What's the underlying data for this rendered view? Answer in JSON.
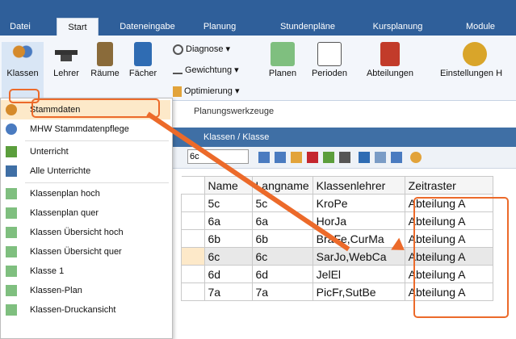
{
  "ribbon_tabs": [
    "Datei",
    "Start",
    "Dateneingabe",
    "Planung",
    "Stundenpläne",
    "Kursplanung",
    "Module"
  ],
  "ribbon_large_buttons": [
    "Klassen",
    "Lehrer",
    "Räume",
    "Fächer",
    "Planen",
    "Perioden",
    "Abteilungen",
    "Einstellungen H"
  ],
  "ribbon_small_buttons": [
    "Diagnose ▾",
    "Gewichtung ▾",
    "Optimierung ▾"
  ],
  "ribbon_group": "Planungswerkzeuge",
  "menu_items": [
    "Stammdaten",
    "MHW Stammdatenpflege",
    "Unterricht",
    "Alle Unterrichte",
    "Klassenplan hoch",
    "Klassenplan quer",
    "Klassen Übersicht hoch",
    "Klassen Übersicht quer",
    "Klasse 1",
    "Klassen-Plan",
    "Klassen-Druckansicht"
  ],
  "panel": {
    "title": "Klassen / Klasse",
    "selector_value": "6c"
  },
  "table": {
    "headers": [
      "Name",
      "Langname",
      "Klassenlehrer",
      "Zeitraster"
    ],
    "rows": [
      [
        "5c",
        "5c",
        "KroPe",
        "Abteilung A"
      ],
      [
        "6a",
        "6a",
        "HorJa",
        "Abteilung A"
      ],
      [
        "6b",
        "6b",
        "BraFe,CurMa",
        "Abteilung A"
      ],
      [
        "6c",
        "6c",
        "SarJo,WebCa",
        "Abteilung A"
      ],
      [
        "6d",
        "6d",
        "JelEl",
        "Abteilung A"
      ],
      [
        "7a",
        "7a",
        "PicFr,SutBe",
        "Abteilung A"
      ]
    ]
  },
  "colors": {
    "ribbon": "#2f5f9a",
    "accent": "#ec6a2a"
  }
}
